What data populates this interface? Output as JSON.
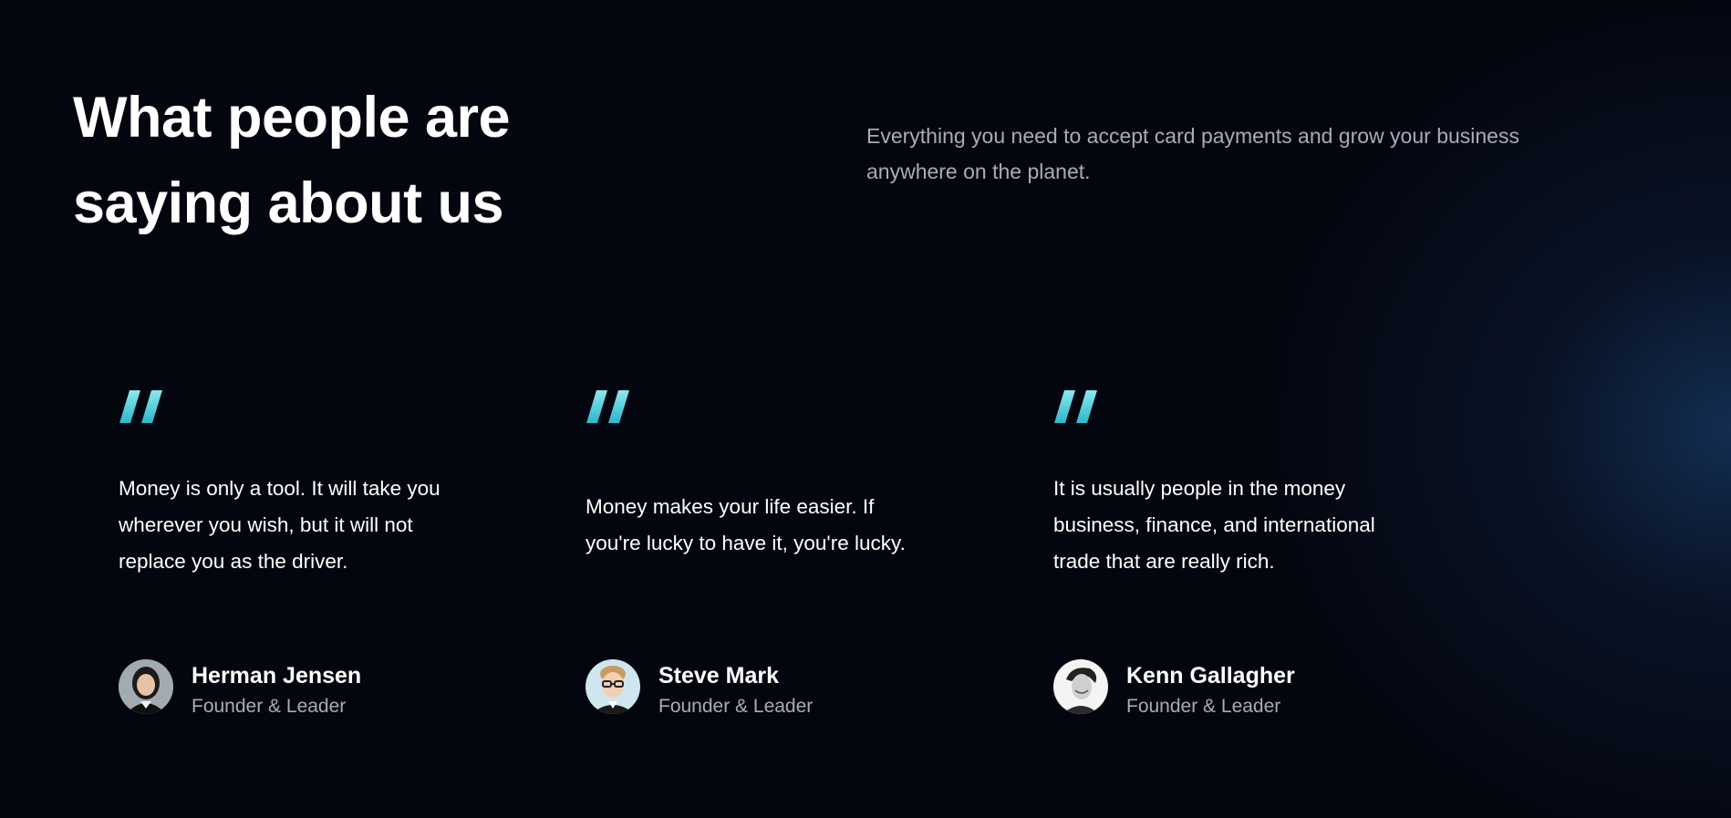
{
  "header": {
    "title": "What people are saying about us",
    "description": "Everything you need to accept card payments and grow your business anywhere on the planet."
  },
  "colors": {
    "background": "#04060f",
    "quote_accent_top": "#8be9ef",
    "quote_accent_bottom": "#2bb6c8",
    "muted_text": "#a9acb6"
  },
  "testimonials": [
    {
      "quote": "Money is only a tool. It will take you wherever you wish, but it will not replace you as the driver.",
      "name": "Herman Jensen",
      "role": "Founder & Leader",
      "avatar_icon": "avatar-woman-photo"
    },
    {
      "quote": "Money makes your life easier. If you're lucky to have it, you're lucky.",
      "name": "Steve Mark",
      "role": "Founder & Leader",
      "avatar_icon": "avatar-man-glasses-photo"
    },
    {
      "quote": "It is usually people in the money business, finance, and international trade that are really rich.",
      "name": "Kenn Gallagher",
      "role": "Founder & Leader",
      "avatar_icon": "avatar-man-bw-photo"
    }
  ]
}
